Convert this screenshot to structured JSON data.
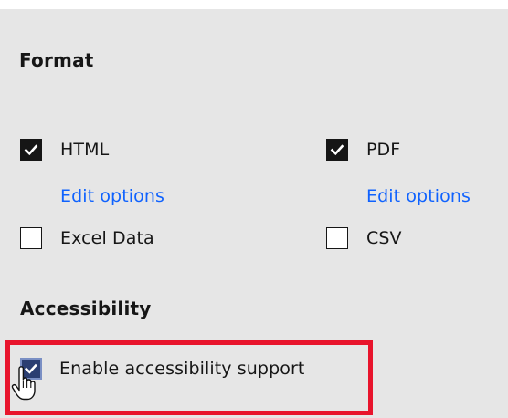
{
  "format": {
    "heading": "Format",
    "options": [
      {
        "label": "HTML",
        "checked": true,
        "edit_link": "Edit options"
      },
      {
        "label": "PDF",
        "checked": true,
        "edit_link": "Edit options"
      },
      {
        "label": "Excel Data",
        "checked": false
      },
      {
        "label": "CSV",
        "checked": false
      }
    ]
  },
  "accessibility": {
    "heading": "Accessibility",
    "option": {
      "label": "Enable accessibility support",
      "checked": true
    }
  },
  "colors": {
    "panel_bg": "#e6e6e6",
    "text": "#161616",
    "link": "#0f62fe",
    "highlight": "#e8142c"
  },
  "icons": {
    "checkmark": "checkmark-icon",
    "cursor": "hand-pointer-cursor-icon"
  }
}
